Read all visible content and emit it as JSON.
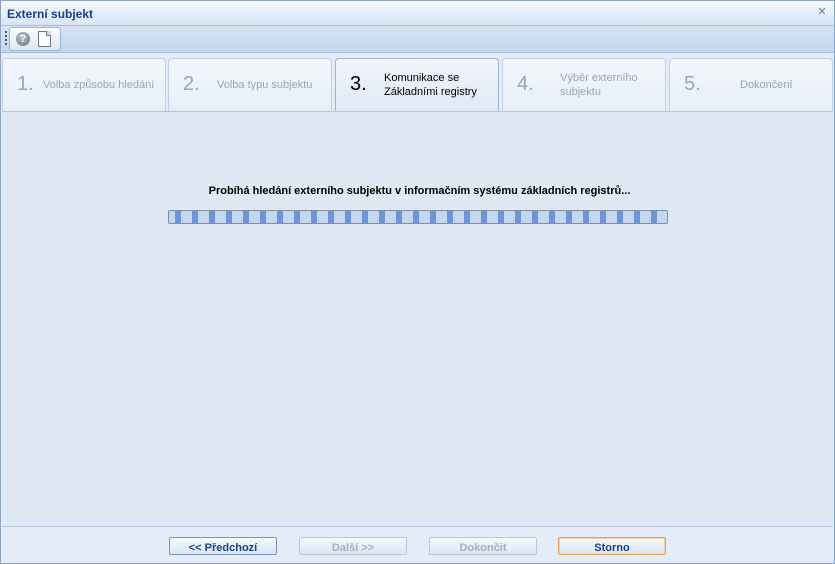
{
  "window": {
    "title": "Externí subjekt",
    "close_glyph": "✕"
  },
  "toolbar": {
    "help_glyph": "?"
  },
  "steps": [
    {
      "number": "1.",
      "label": "Volba způsobu hledání",
      "state": "inactive"
    },
    {
      "number": "2.",
      "label": "Volba typu subjektu",
      "state": "inactive"
    },
    {
      "number": "3.",
      "label": "Komunikace se Základními registry",
      "state": "active"
    },
    {
      "number": "4.",
      "label": "Výběr externího subjektu",
      "state": "inactive"
    },
    {
      "number": "5.",
      "label": "Dokončení",
      "state": "inactive"
    }
  ],
  "content": {
    "message": "Probíhá hledání externího subjektu v informačním systému základních registrů...",
    "progress": "indeterminate"
  },
  "footer": {
    "prev_label": "<< Předchozí",
    "next_label": "Další >>",
    "finish_label": "Dokončit",
    "cancel_label": "Storno"
  },
  "colors": {
    "title_text": "#15428b",
    "progress_fill": "#6f95d6",
    "focus_border": "#e3a35c"
  }
}
